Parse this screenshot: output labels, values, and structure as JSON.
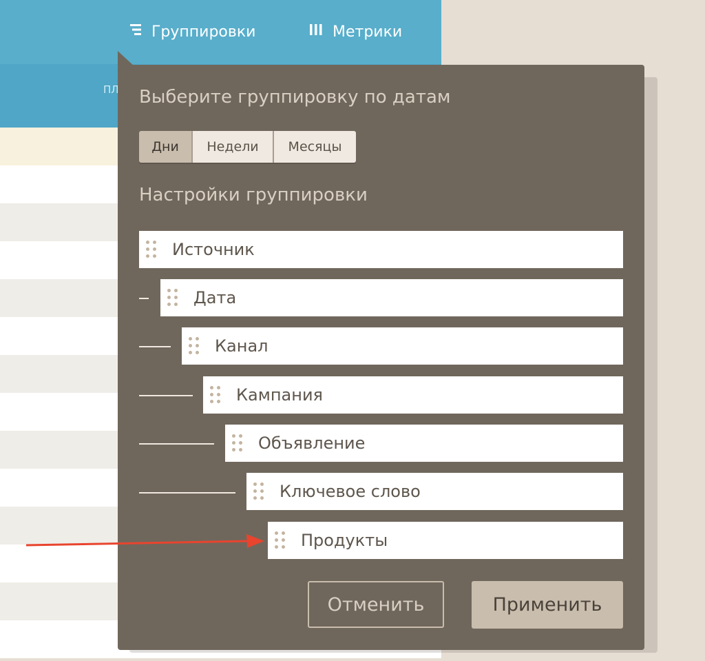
{
  "nav": {
    "groupings_label": "Группировки",
    "metrics_label": "Метрики",
    "groupings_icon": "list-lines-icon",
    "metrics_icon": "columns-icon"
  },
  "background": {
    "subbar_text": "ПЛ"
  },
  "popup": {
    "date_title": "Выберите группировку по датам",
    "date_options": [
      "Дни",
      "Недели",
      "Месяцы"
    ],
    "date_selected": "Дни",
    "settings_title": "Настройки группировки",
    "groupings": [
      "Источник",
      "Дата",
      "Канал",
      "Кампания",
      "Объявление",
      "Ключевое слово",
      "Продукты"
    ],
    "cancel_label": "Отменить",
    "apply_label": "Применить"
  },
  "colors": {
    "popup_bg": "#70675c",
    "topbar": "#58aecb",
    "accent_button": "#c9bdad",
    "annotation_arrow": "#e8442e"
  }
}
